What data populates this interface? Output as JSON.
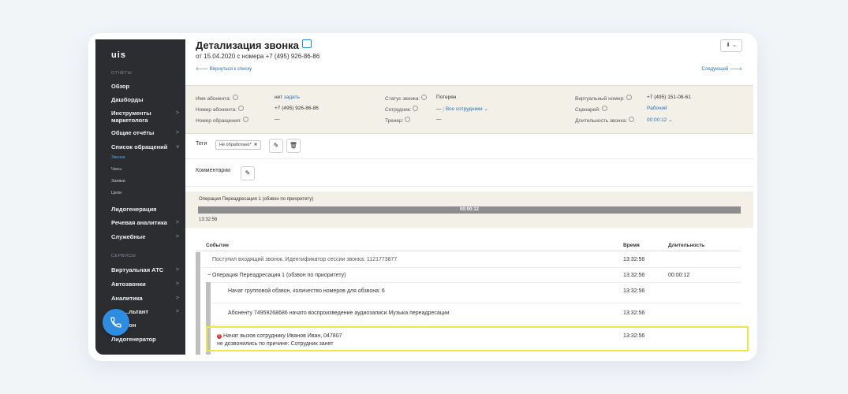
{
  "sidebar": {
    "logo": "uis",
    "section_reports": "ОТЧЁТЫ",
    "items_top": [
      {
        "label": "Обзор",
        "chev": ""
      },
      {
        "label": "Дашборды",
        "chev": ""
      },
      {
        "label": "Инструменты маркетолога",
        "chev": ">"
      },
      {
        "label": "Общие отчёты",
        "chev": ">"
      },
      {
        "label": "Список обращений",
        "chev": "v"
      }
    ],
    "subitems": [
      "Звонки",
      "Чаты",
      "Заявки",
      "Цели"
    ],
    "items_mid": [
      {
        "label": "Лидогенерация",
        "chev": ""
      },
      {
        "label": "Речевая аналитика",
        "chev": ">"
      },
      {
        "label": "Служебные",
        "chev": ">"
      }
    ],
    "section_services": "СЕРВИСЫ",
    "items_bottom": [
      {
        "label": "Виртуальная АТС",
        "chev": ">"
      },
      {
        "label": "Автозвонки",
        "chev": ">"
      },
      {
        "label": "Аналитика",
        "chev": ">"
      },
      {
        "label": "...льтант",
        "chev": ">"
      },
      {
        "label": "...он",
        "chev": ""
      },
      {
        "label": "Лидогенератор",
        "chev": ""
      }
    ]
  },
  "header": {
    "title": "Детализация звонка",
    "subtitle": "от 15.04.2020 с номера +7 (495) 926-86-86",
    "back_link": "Вернуться к списку",
    "next_link": "Следующий",
    "download": "⬇ ⌄"
  },
  "info": {
    "col1": [
      {
        "label": "Имя абонента:",
        "value": "нет",
        "action": "задать"
      },
      {
        "label": "Номер абонента:",
        "value": "+7 (495) 926-86-86"
      },
      {
        "label": "Номер обращения:",
        "value": "—"
      }
    ],
    "col2": [
      {
        "label": "Статус звонка:",
        "value": "Потерян"
      },
      {
        "label": "Сотрудник:",
        "value": "—",
        "action": "Все сотрудники"
      },
      {
        "label": "Тренер:",
        "value": "—"
      }
    ],
    "col3": [
      {
        "label": "Виртуальный номер:",
        "value": "+7 (495) 151-08-61"
      },
      {
        "label": "Сценарий:",
        "value": "Рабочий"
      },
      {
        "label": "Длительность звонка:",
        "value": "00:00:12"
      }
    ]
  },
  "tags": {
    "label": "Теги",
    "tag": "Не обработано"
  },
  "comments": {
    "label": "Комментарии"
  },
  "operation": {
    "title": "Операция Переадресация 1 (обзвон по приоритету)",
    "duration": "00:00:12",
    "time": "13:32:56"
  },
  "table": {
    "headers": {
      "event": "Событие",
      "time": "Время",
      "duration": "Длительность"
    },
    "rows": [
      {
        "event": "Поступил входящий звонок. Идентификатор сессии звонка: 1121773877",
        "time": "13:32:56",
        "duration": ""
      },
      {
        "event": "Операция Переадресация 1 (обзвон по приоритету)",
        "time": "13:32:56",
        "duration": "00:00:12"
      },
      {
        "event": "Начат групповой обзвон, количество номеров для обзвона: 6",
        "time": "13:32:56",
        "duration": ""
      },
      {
        "event": "Абоненту 74959268686 начато воспроизведение аудиозаписи Музыка переадресации",
        "time": "13:32:56",
        "duration": ""
      },
      {
        "event": "Начат вызов сотруднику Иванов Иван, 047807",
        "event2": "не дозвонились по причине: Сотрудник занят",
        "time": "13:32:56",
        "duration": ""
      }
    ]
  }
}
